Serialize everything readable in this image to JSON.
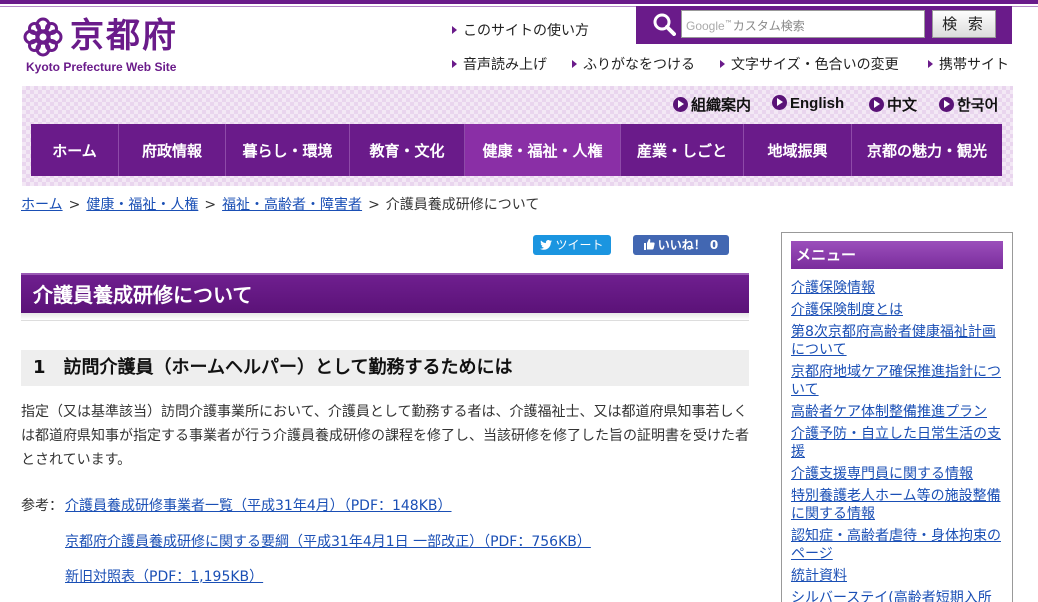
{
  "logo": {
    "jp": "京都府",
    "en": "Kyoto Prefecture Web Site"
  },
  "utility": {
    "howto": "このサイトの使い方",
    "voice": "音声読み上げ",
    "furigana": "ふりがなをつける",
    "textsize": "文字サイズ・色合いの変更",
    "mobile": "携帯サイト"
  },
  "search": {
    "placeholder_google": "Google",
    "placeholder_tm": "™",
    "placeholder_text": "カスタム検索",
    "button": "検 索"
  },
  "languages": [
    "組織案内",
    "English",
    "中文",
    "한국어"
  ],
  "gnav": [
    "ホーム",
    "府政情報",
    "暮らし・環境",
    "教育・文化",
    "健康・福祉・人権",
    "産業・しごと",
    "地域振興",
    "京都の魅力・観光"
  ],
  "breadcrumb": {
    "items": [
      "ホーム",
      "健康・福祉・人権",
      "福祉・高齢者・障害者"
    ],
    "current": "介護員養成研修について",
    "sep": ">"
  },
  "social": {
    "tweet": "ツイート",
    "like": "いいね！ 0"
  },
  "page": {
    "title": "介護員養成研修について",
    "section1": "1　訪問介護員（ホームヘルパー）として勤務するためには",
    "paragraph": "指定（又は基準該当）訪問介護事業所において、介護員として勤務する者は、介護福祉士、又は都道府県知事若しくは都道府県知事が指定する事業者が行う介護員養成研修の課程を修了し、当該研修を修了した旨の証明書を受けた者とされています。",
    "ref_label": "参考：",
    "refs": [
      "介護員養成研修事業者一覧（平成31年4月）（PDF：148KB）",
      "京都府介護員養成研修に関する要綱（平成31年4月1日 一部改正）（PDF：756KB）",
      "新旧対照表（PDF：1,195KB）"
    ]
  },
  "sidebar": {
    "title": "メニュー",
    "links": [
      "介護保険情報",
      "介護保険制度とは",
      "第8次京都府高齢者健康福祉計画について",
      "京都府地域ケア確保推進指針について",
      "高齢者ケア体制整備推進プラン",
      "介護予防・自立した日常生活の支援",
      "介護支援専門員に関する情報",
      "特別養護老人ホーム等の施設整備に関する情報",
      "認知症・高齢者虐待・身体拘束のページ",
      "統計資料",
      "シルバーステイ(高齢者短期入所"
    ]
  },
  "colors": {
    "brand": "#6a1b8a",
    "link": "#1a4fb5"
  }
}
